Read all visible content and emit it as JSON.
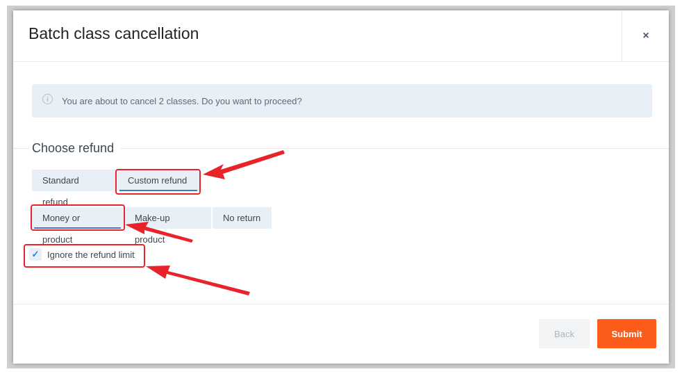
{
  "dialog": {
    "title": "Batch class cancellation",
    "close_glyph": "×"
  },
  "alert": {
    "icon": "info-icon",
    "text": "You are about to cancel 2 classes. Do you want to proceed?"
  },
  "refund": {
    "section_title": "Choose refund",
    "types": [
      {
        "label": "Standard refund",
        "active": false
      },
      {
        "label": "Custom refund",
        "active": true
      }
    ],
    "methods": [
      {
        "label": "Money or product",
        "active": true
      },
      {
        "label": "Make-up product",
        "active": false
      },
      {
        "label": "No return",
        "active": false
      }
    ],
    "ignore_limit": {
      "label": "Ignore the refund limit",
      "checked": true,
      "check_glyph": "✓"
    }
  },
  "footer": {
    "back_label": "Back",
    "submit_label": "Submit"
  },
  "colors": {
    "accent": "#fc5b1a",
    "annotation": "#e8232a",
    "tab_active_underline": "#3b7bbf"
  }
}
